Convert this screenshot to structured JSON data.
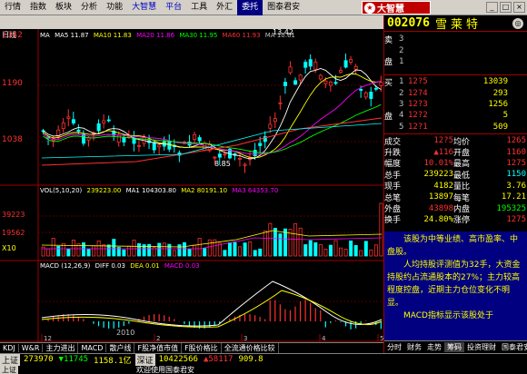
{
  "menu": [
    "行情",
    "指数",
    "板块",
    "分析",
    "功能",
    "大智慧",
    "平台",
    "工具",
    "外汇",
    "委托",
    "图泰君安"
  ],
  "brand": {
    "name": "大智慧"
  },
  "stock": {
    "code": "002076",
    "name": "雪莱特"
  },
  "period_label": "日线",
  "ma_legend": {
    "label": "MA",
    "ma5": "MA5 11.87",
    "ma10": "MA10 11.83",
    "ma20": "MA20 11.86",
    "ma30": "MA30 11.95",
    "ma60": "MA60 11.93",
    "ma": "MA 10.61"
  },
  "price_axis": [
    "1342",
    "1190",
    "1038"
  ],
  "hi_label": "13.42",
  "lo_label": "8.85",
  "vol_legend": {
    "vol": "VOL(5,10,20)",
    "v": "239223.00",
    "ma1": "MA1 104303.80",
    "ma2": "MA2 80191.10",
    "ma3": "MA3 64353.70"
  },
  "vol_axis": [
    "39223",
    "19562",
    "X10"
  ],
  "macd_legend": {
    "macd": "MACD (12,26,9)",
    "diff": "DIFF 0.03",
    "dea": "DEA 0.01",
    "macdv": "MACD 0.03"
  },
  "year_label": "2010",
  "x_ticks": [
    "12",
    "2",
    "3",
    "4",
    "5"
  ],
  "bottom_tabs": [
    "KDJ",
    "W&R",
    "主力进出",
    "MACD",
    "散户线",
    "F股净值市值",
    "F股价格比",
    "全流通价格比较"
  ],
  "quote": {
    "sells": [
      {
        "label": "卖",
        "lvl": "3",
        "price": "",
        "vol": ""
      },
      {
        "label": "",
        "lvl": "2",
        "price": "",
        "vol": ""
      },
      {
        "label": "盘",
        "lvl": "1",
        "price": "",
        "vol": ""
      }
    ],
    "buys": [
      {
        "label": "买",
        "lvl": "1",
        "price": "12?5",
        "vol": "13039"
      },
      {
        "label": "",
        "lvl": "2",
        "price": "12?4",
        "vol": "293"
      },
      {
        "label": "",
        "lvl": "3",
        "price": "12?3",
        "vol": "1256"
      },
      {
        "label": "盘",
        "lvl": "4",
        "price": "12?2",
        "vol": "5"
      },
      {
        "label": "",
        "lvl": "5",
        "price": "12?1",
        "vol": "509"
      }
    ],
    "stats": [
      {
        "l": "成交",
        "v": "12?5",
        "l2": "均价",
        "v2": "1265"
      },
      {
        "l": "升跌",
        "v": "▲116",
        "l2": "开盘",
        "v2": "1160"
      },
      {
        "l": "幅度",
        "v": "10.01%",
        "l2": "最高",
        "v2": "1275"
      },
      {
        "l": "总手",
        "v": "239223",
        "l2": "最低",
        "v2": "1150"
      },
      {
        "l": "现手",
        "v": "4182",
        "l2": "量比",
        "v2": "3.76"
      },
      {
        "l": "总笔",
        "v": "13897",
        "l2": "每笔",
        "v2": "17.21"
      },
      {
        "l": "外盘",
        "v": "43898",
        "l2": "内盘",
        "v2": "195325"
      },
      {
        "l": "换手",
        "v": "24.80%",
        "l2": "涨停",
        "v2": "1275"
      }
    ]
  },
  "commentary": [
    "该股为中等业绩、高市盈率、中盘股。",
    "人均持股评测值为32手，大资金持股约占流通股本的27%；主力较高程度控盘，近期主力仓位变化不明显。",
    "MACD指标显示该股处于"
  ],
  "right_tabs": [
    "分时",
    "财务",
    "走势",
    "筹码",
    "投资理财",
    "国泰君安"
  ],
  "status_line1": {
    "tag1": "上证",
    "v1": "273970",
    "a1": "▼11745",
    "v2": "1158.1亿",
    "tag2": "深证",
    "v3": "10422566",
    "a2": "▲58117",
    "v4": "909.8"
  },
  "status_line2": {
    "tag": "上证",
    "text": "欢迎使用国泰君安"
  },
  "colors": {
    "up": "#ff3030",
    "down": "#00ffff",
    "ma5": "#ffffff",
    "ma10": "#ffff00",
    "ma20": "#ff00ff",
    "ma30": "#00ff00",
    "ma60": "#ff3030"
  }
}
